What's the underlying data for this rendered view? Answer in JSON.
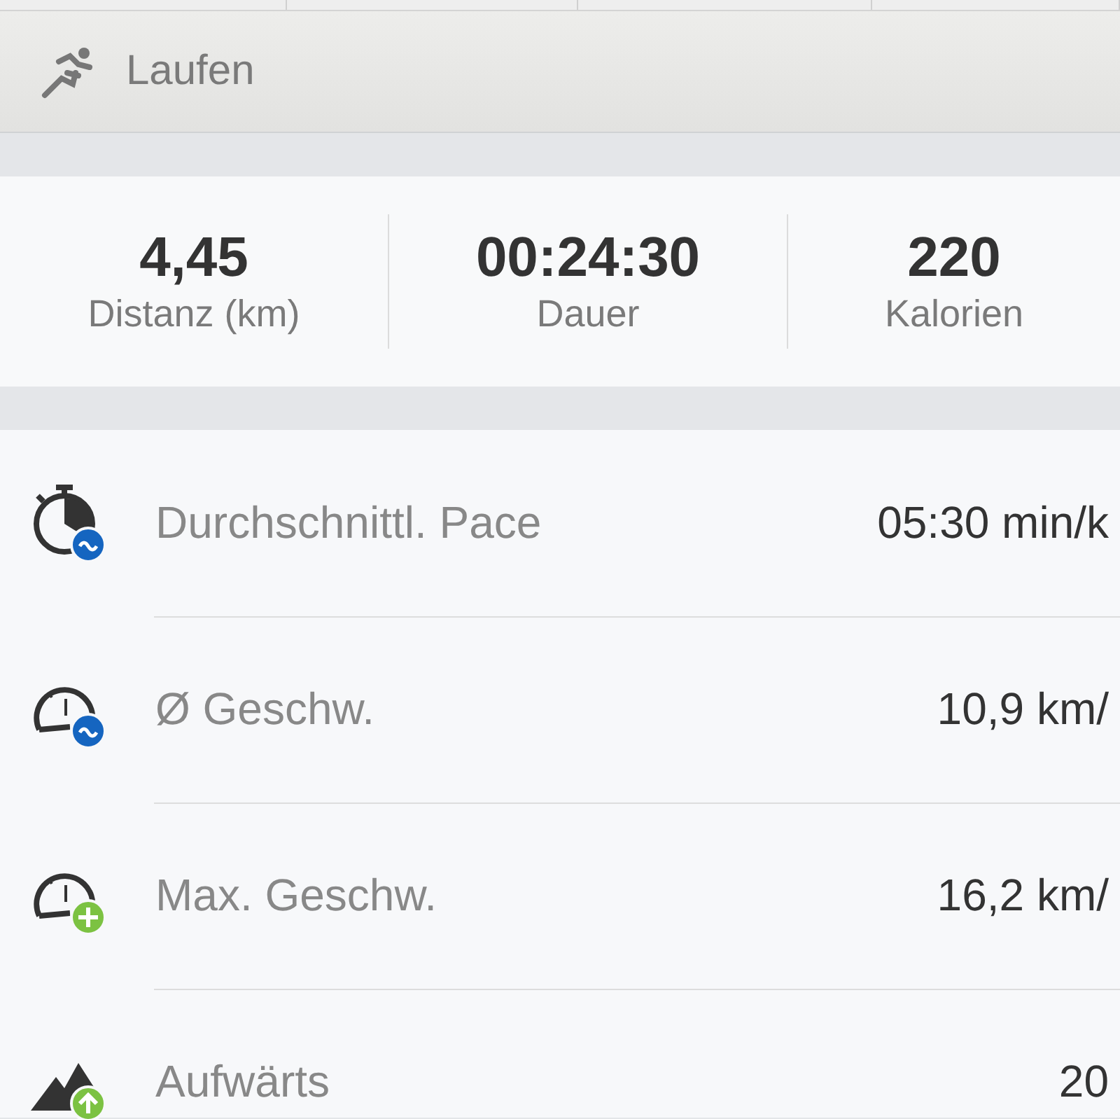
{
  "header": {
    "title": "Laufen"
  },
  "summary": [
    {
      "value": "4,45",
      "label": "Distanz (km)"
    },
    {
      "value": "00:24:30",
      "label": "Dauer"
    },
    {
      "value": "220",
      "label": "Kalorien"
    }
  ],
  "metrics": [
    {
      "kind": "pace",
      "label": "Durchschnittl. Pace",
      "value": "05:30 min/k"
    },
    {
      "kind": "avg-speed",
      "label": "Ø Geschw.",
      "value": "10,9 km/"
    },
    {
      "kind": "max-speed",
      "label": "Max. Geschw.",
      "value": "16,2 km/"
    },
    {
      "kind": "ascent",
      "label": "Aufwärts",
      "value": "20"
    }
  ]
}
